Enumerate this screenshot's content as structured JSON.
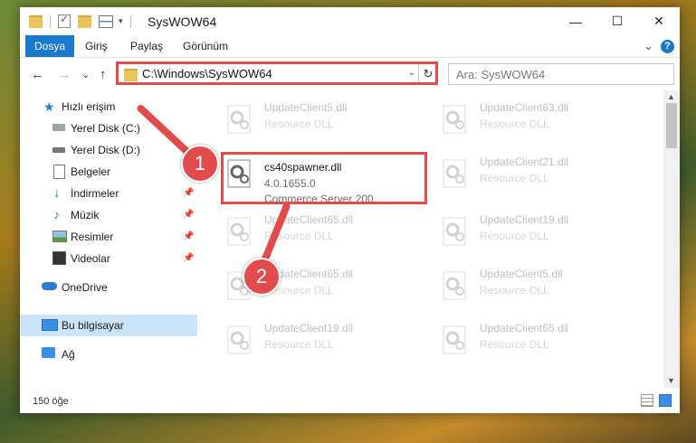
{
  "window": {
    "title": "SysWOW64"
  },
  "titlebar": {
    "minimize": "—",
    "maximize": "☐",
    "close": "✕"
  },
  "ribbon": {
    "tabs": [
      "Dosya",
      "Giriş",
      "Paylaş",
      "Görünüm"
    ],
    "expand": "⌄",
    "help": "?"
  },
  "nav": {
    "back": "←",
    "forward": "→",
    "recent": "⌄",
    "up": "↑"
  },
  "address": {
    "path": "C:\\Windows\\SysWOW64",
    "chevron": "⌄",
    "refresh": "↻"
  },
  "search": {
    "placeholder": "Ara: SysWOW64"
  },
  "sidebar": {
    "items": [
      {
        "label": "Hızlı erişim",
        "pinned": false
      },
      {
        "label": "Yerel Disk (C:)",
        "pinned": false
      },
      {
        "label": "Yerel Disk (D:)",
        "pinned": false
      },
      {
        "label": "Belgeler",
        "pinned": true
      },
      {
        "label": "İndirmeler",
        "pinned": true
      },
      {
        "label": "Müzik",
        "pinned": true
      },
      {
        "label": "Resimler",
        "pinned": true
      },
      {
        "label": "Videolar",
        "pinned": true
      },
      {
        "label": "OneDrive",
        "pinned": false
      },
      {
        "label": "Bu bilgisayar",
        "pinned": false
      },
      {
        "label": "Ağ",
        "pinned": false
      }
    ]
  },
  "files": [
    {
      "name": "UpdateClient5.dll",
      "desc": "Resource DLL",
      "faded": true
    },
    {
      "name": "UpdateClient63.dll",
      "desc": "Resource DLL",
      "faded": true
    },
    {
      "name": "cs40spawner.dll",
      "desc": "4.0.1655.0",
      "desc2": "Commerce Server 200...",
      "faded": false
    },
    {
      "name": "UpdateClient21.dll",
      "desc": "Resource DLL",
      "faded": true
    },
    {
      "name": "UpdateClient65.dll",
      "desc": "Resource DLL",
      "faded": true
    },
    {
      "name": "UpdateClient19.dll",
      "desc": "Resource DLL",
      "faded": true
    },
    {
      "name": "UpdateClient65.dll",
      "desc": "Resource DLL",
      "faded": true
    },
    {
      "name": "UpdateClient5.dll",
      "desc": "Resource DLL",
      "faded": true
    },
    {
      "name": "UpdateClient19.dll",
      "desc": "Resource DLL",
      "faded": true
    },
    {
      "name": "UpdateClient65.dll",
      "desc": "Resource DLL",
      "faded": true
    }
  ],
  "status": {
    "count": "150 öğe"
  },
  "annotations": {
    "step1": "1",
    "step2": "2",
    "color": "#e14b4b"
  }
}
